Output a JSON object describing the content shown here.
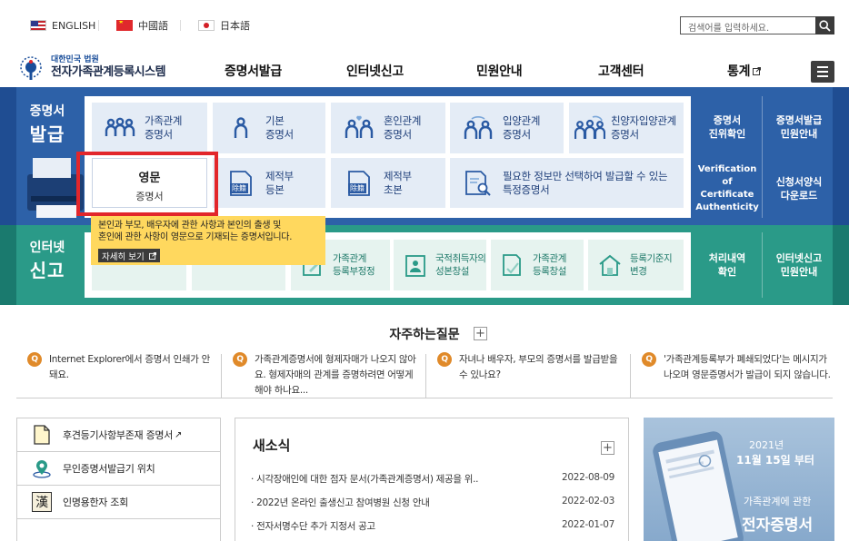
{
  "languages": [
    {
      "label": "ENGLISH",
      "flag": "us-flag-icon"
    },
    {
      "label": "中國語",
      "flag": "cn-flag-icon"
    },
    {
      "label": "日本語",
      "flag": "jp-flag-icon"
    }
  ],
  "search": {
    "placeholder": "검색어를 입력하세요."
  },
  "logo": {
    "small": "대한민국 법원",
    "big": "전자가족관계등록시스템"
  },
  "nav": [
    "증명서발급",
    "인터넷신고",
    "민원안내",
    "고객센터",
    "통계"
  ],
  "cert_section": {
    "title_top": "증명서",
    "title_big": "발급",
    "cards_row1": [
      {
        "line1": "가족관계",
        "line2": "증명서"
      },
      {
        "line1": "기본",
        "line2": "증명서"
      },
      {
        "line1": "혼인관계",
        "line2": "증명서"
      },
      {
        "line1": "입양관계",
        "line2": "증명서"
      },
      {
        "line1": "친양자입양관계",
        "line2": "증명서"
      }
    ],
    "english_card": {
      "line1": "영문",
      "line2": "증명서"
    },
    "cards_row2": [
      {
        "line1": "제적부",
        "line2": "등본",
        "badge": "除籍"
      },
      {
        "line1": "제적부",
        "line2": "초본",
        "badge": "除籍"
      },
      {
        "line1": "필요한 정보만 선택하여 발급할 수 있는",
        "line2": "특정증명서"
      }
    ],
    "side_links": [
      {
        "line1": "증명서",
        "line2": "진위확인"
      },
      {
        "line1": "증명서발급",
        "line2": "민원안내"
      },
      {
        "line1": "Verification of",
        "line2": "Certificate",
        "line3": "Authenticity"
      },
      {
        "line1": "신청서양식",
        "line2": "다운로드"
      }
    ]
  },
  "tooltip": {
    "line1": "본인과 부모, 배우자에 관한 사항과 본인의 출생 및",
    "line2": "혼인에 관한 사항이 영문으로 기재되는 증명서입니다.",
    "button": "자세히 보기"
  },
  "report_section": {
    "title_top": "인터넷",
    "title_big": "신고",
    "cards": [
      {
        "line1": "가족관계",
        "line2": "등록부정정"
      },
      {
        "line1": "국적취득자의",
        "line2": "성본창설"
      },
      {
        "line1": "가족관계",
        "line2": "등록창설"
      },
      {
        "line1": "등록기준지",
        "line2": "변경"
      }
    ],
    "side_links": [
      {
        "line1": "처리내역",
        "line2": "확인"
      },
      {
        "line1": "인터넷신고",
        "line2": "민원안내"
      }
    ]
  },
  "faq": {
    "title": "자주하는질문",
    "items": [
      {
        "text": "Internet Explorer에서 증명서 인쇄가 안돼요."
      },
      {
        "text": "가족관계증명서에 형제자매가 나오지 않아요. 형제자매의 관계를 증명하려면 어떻게 해야 하나요..."
      },
      {
        "text": "자녀나 배우자, 부모의 증명서를 발급받을 수 있나요?"
      },
      {
        "text": "'가족관계등록부가 폐쇄되었다'는 메시지가 나오며 영문증명서가 발급이 되지 않습니다."
      }
    ]
  },
  "quick_links": [
    {
      "label": "후견등기사항부존재 증명서",
      "icon": "document-icon",
      "external": "↗"
    },
    {
      "label": "무인증명서발급기 위치",
      "icon": "location-pin-icon"
    },
    {
      "label": "인명용한자 조회",
      "icon": "hanja-icon",
      "glyph": "漢"
    }
  ],
  "news": {
    "title": "새소식",
    "items": [
      {
        "title": "시각장애인에 대한 점자 문서(가족관계증명서) 제공을 위..",
        "date": "2022-08-09"
      },
      {
        "title": "2022년 온라인 출생신고 참여병원 신청 안내",
        "date": "2022-02-03"
      },
      {
        "title": "전자서명수단 추가 지정서 공고",
        "date": "2022-01-07"
      }
    ]
  },
  "banner": {
    "year": "2021년",
    "date": "11월 15일 부터",
    "sub": "가족관계에 관한",
    "main": "전자증명서"
  },
  "colors": {
    "cert_band": "#2d61a8",
    "report_band": "#2a9a88",
    "highlight": "#e2262b",
    "tooltip": "#ffd85e"
  }
}
